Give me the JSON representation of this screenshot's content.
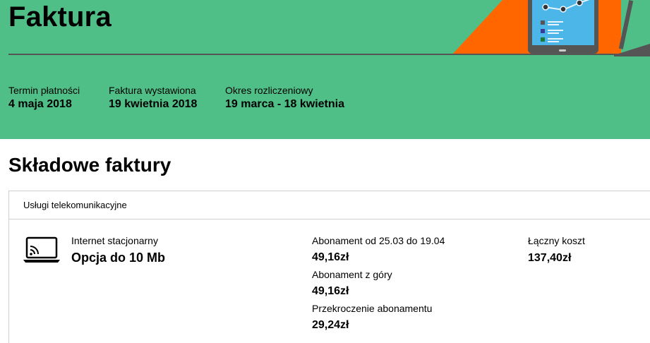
{
  "header": {
    "title": "Faktura",
    "meta": [
      {
        "label": "Termin płatności",
        "value": "4 maja 2018"
      },
      {
        "label": "Faktura wystawiona",
        "value": "19 kwietnia 2018"
      },
      {
        "label": "Okres rozliczeniowy",
        "value": "19 marca - 18 kwietnia"
      }
    ]
  },
  "section": {
    "title": "Składowe faktury"
  },
  "card": {
    "heading": "Usługi telekomunikacyjne",
    "service": {
      "icon": "laptop-icon",
      "label": "Internet stacjonarny",
      "name": "Opcja do 10 Mb"
    },
    "fees": [
      {
        "label": "Abonament od 25.03 do 19.04",
        "amount": "49,16zł"
      },
      {
        "label": "Abonament z góry",
        "amount": "49,16zł"
      },
      {
        "label": "Przekroczenie abonamentu",
        "amount": "29,24zł"
      }
    ],
    "total": {
      "label": "Łączny koszt",
      "amount": "137,40zł"
    }
  },
  "colors": {
    "hero_bg": "#50bf87",
    "accent_orange": "#ff6600",
    "tablet_screen": "#4db6e8"
  }
}
